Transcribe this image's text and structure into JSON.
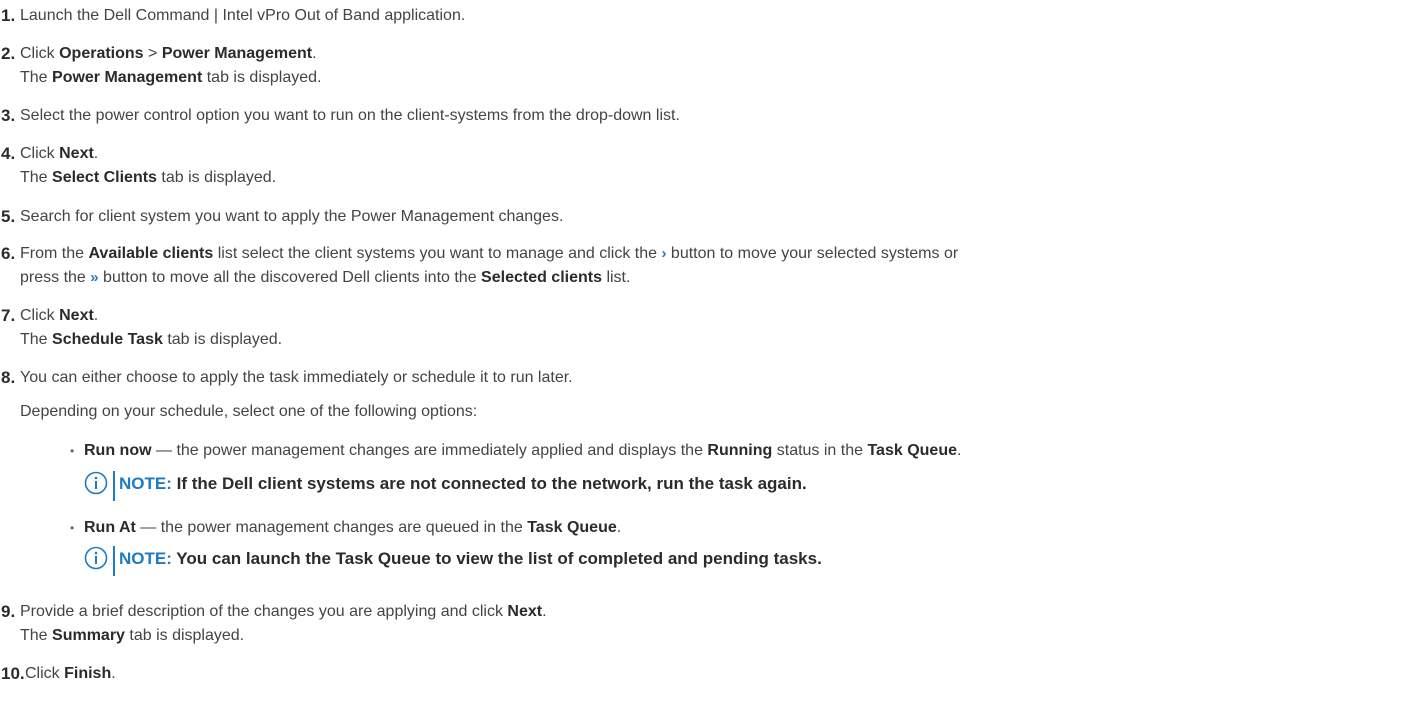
{
  "steps": [
    {
      "num": "1.",
      "parts": [
        "Launch the Dell Command | Intel vPro Out of Band application."
      ]
    },
    {
      "num": "2.",
      "l1": [
        "Click ",
        "Operations",
        " > ",
        "Power Management",
        "."
      ],
      "l2": [
        "The ",
        "Power Management",
        " tab is displayed."
      ]
    },
    {
      "num": "3.",
      "parts": [
        "Select the power control option you want to run on the client-systems from the drop-down list."
      ]
    },
    {
      "num": "4.",
      "l1": [
        "Click ",
        "Next",
        "."
      ],
      "l2": [
        "The ",
        "Select Clients",
        " tab is displayed."
      ]
    },
    {
      "num": "5.",
      "parts": [
        "Search for client system you want to apply the Power Management changes."
      ]
    },
    {
      "num": "6.",
      "l1": [
        "From the ",
        "Available clients",
        " list select the client systems you want to manage and click the ",
        "›",
        " button to move your selected systems or"
      ],
      "l2": [
        "press the ",
        "»",
        " button to move all the discovered Dell clients into the ",
        "Selected clients",
        " list."
      ]
    },
    {
      "num": "7.",
      "l1": [
        "Click ",
        "Next",
        "."
      ],
      "l2": [
        "The ",
        "Schedule Task",
        " tab is displayed."
      ]
    },
    {
      "num": "8.",
      "parts": [
        "You can either choose to apply the task immediately or schedule it to run later."
      ],
      "sub": "Depending on your schedule, select one of the following options:"
    },
    {
      "num": "9.",
      "l1": [
        "Provide a brief description of the changes you are applying and click ",
        "Next",
        "."
      ],
      "l2": [
        "The ",
        "Summary",
        " tab is displayed."
      ]
    },
    {
      "num": "10.",
      "l1": [
        "Click ",
        "Finish",
        "."
      ]
    }
  ],
  "options": [
    {
      "bullet": "•",
      "name": "Run now",
      "parts": [
        " — the power management changes are immediately applied and displays the ",
        "Running",
        " status in the ",
        "Task Queue",
        "."
      ],
      "note_label": "NOTE:",
      "note_text": " If the Dell client systems are not connected to the network, run the task again."
    },
    {
      "bullet": "•",
      "name": "Run At",
      "parts": [
        " — the power management changes are queued in the ",
        "Task Queue",
        "."
      ],
      "note_label": "NOTE:",
      "note_text": " You can launch the Task Queue to view the list of completed and pending tasks."
    }
  ],
  "colors": {
    "accent": "#1d7ac4",
    "text": "#444444",
    "bold": "#2b2b2b"
  }
}
